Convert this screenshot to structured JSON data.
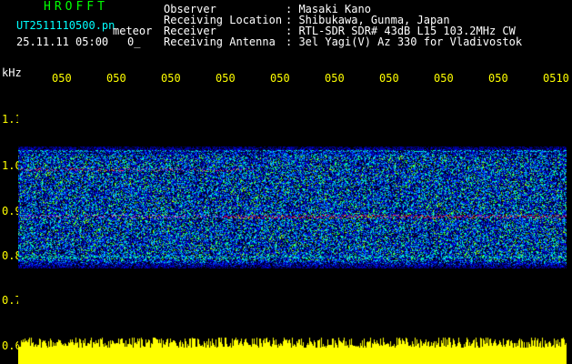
{
  "header": {
    "app_title": "HROFFT",
    "file_name": "UT2511110500.pn",
    "mode": "meteor",
    "date_time": "25.11.11 05:00",
    "status_value": "0_"
  },
  "station_info": [
    {
      "label": "Observer",
      "value": ": Masaki Kano"
    },
    {
      "label": "Receiving Location",
      "value": ": Shibukawa, Gunma, Japan"
    },
    {
      "label": "Receiver",
      "value": ": RTL-SDR SDR# 43dB L15 103.2MHz CW"
    },
    {
      "label": "Receiving Antenna",
      "value": ": 3el Yagi(V) Az 330 for Vladivostok"
    }
  ],
  "axes": {
    "unit": "kHz",
    "x_ticks": [
      "050",
      "050",
      "050",
      "050",
      "050",
      "050",
      "050",
      "050",
      "050",
      "0510"
    ],
    "y_ticks": [
      "1.1",
      "1.0",
      "0.9",
      "0.8",
      "0.7",
      "0.6"
    ]
  },
  "colors": {
    "text_white": "#ffffff",
    "text_yellow": "#ffff00",
    "text_cyan": "#00ffff",
    "title_green": "#00ff00",
    "signal_strip": "#ffff00",
    "background": "#000000"
  }
}
